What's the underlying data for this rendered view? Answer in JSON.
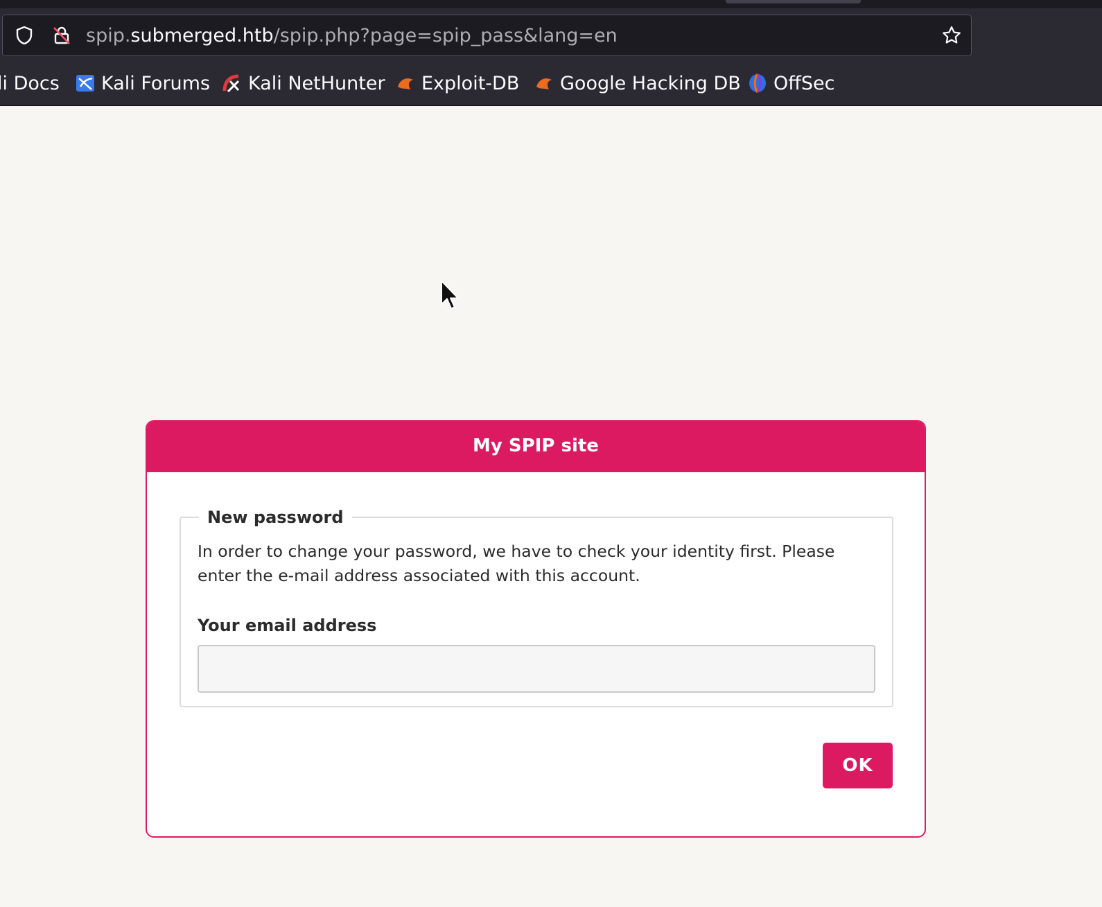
{
  "browser": {
    "url": {
      "subdomain": "spip.",
      "host": "submerged.htb",
      "path": "/spip.php?page=spip_pass&lang=en"
    },
    "icons": {
      "shield": "tracking-protection-shield-icon",
      "lock": "insecure-lock-icon",
      "star": "bookmark-star-icon"
    },
    "bookmarks": [
      {
        "label": "li Docs",
        "icon": ""
      },
      {
        "label": "Kali Forums",
        "icon": "kali-forums-icon"
      },
      {
        "label": "Kali NetHunter",
        "icon": "kali-nethunter-icon"
      },
      {
        "label": "Exploit-DB",
        "icon": "exploit-db-icon"
      },
      {
        "label": "Google Hacking DB",
        "icon": "exploit-db-icon"
      },
      {
        "label": "OffSec",
        "icon": "offsec-icon"
      }
    ]
  },
  "page": {
    "site_title": "My SPIP site",
    "form": {
      "legend": "New password",
      "explanation": "In order to change your password, we have to check your identity first. Please enter the e-mail address associated with this account.",
      "email_label": "Your email address",
      "email_value": "",
      "submit_label": "OK"
    }
  },
  "colors": {
    "accent": "#dc1a61",
    "page_background": "#f7f6f3",
    "chrome_background": "#2b2a33"
  }
}
